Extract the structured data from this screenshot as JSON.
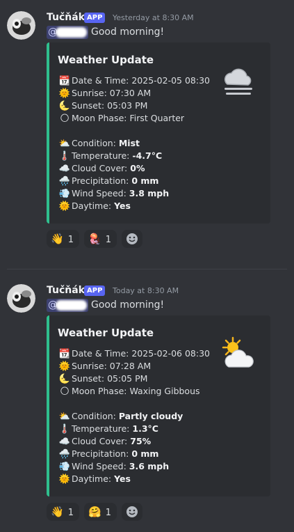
{
  "messages": [
    {
      "author": "Tučňák",
      "badge": "APP",
      "timestamp": "Yesterday at 8:30 AM",
      "mention": "@",
      "greeting": "Good morning!",
      "embed": {
        "title": "Weather Update",
        "thumbnail_icon": "fog-cloud-icon",
        "lines": [
          {
            "icon": "📆",
            "label": "Date & Time: ",
            "value": "2025-02-05 08:30",
            "bold": false
          },
          {
            "icon": "🌞",
            "label": "Sunrise: ",
            "value": "07:30 AM",
            "bold": false
          },
          {
            "icon": "🌜",
            "label": "Sunset: ",
            "value": "05:03 PM",
            "bold": false
          },
          {
            "icon": "🌕",
            "label": "Moon Phase: ",
            "value": "First Quarter",
            "bold": false
          }
        ],
        "conditions": [
          {
            "icon": "⛅",
            "label": "Condition: ",
            "value": "Mist"
          },
          {
            "icon": "🌡️",
            "label": "Temperature: ",
            "value": "-4.7°C"
          },
          {
            "icon": "☁️",
            "label": "Cloud Cover: ",
            "value": "0%"
          },
          {
            "icon": "🌧️",
            "label": "Precipitation: ",
            "value": "0 mm"
          },
          {
            "icon": "💨",
            "label": "Wind Speed: ",
            "value": "3.8 mph"
          },
          {
            "icon": "🌞",
            "label": "Daytime: ",
            "value": "Yes"
          }
        ]
      },
      "reactions": [
        {
          "emoji": "👋",
          "count": "1"
        },
        {
          "emoji": "🪼",
          "count": "1"
        }
      ]
    },
    {
      "author": "Tučňák",
      "badge": "APP",
      "timestamp": "Today at 8:30 AM",
      "mention": "@",
      "greeting": "Good morning!",
      "embed": {
        "title": "Weather Update",
        "thumbnail_icon": "sun-behind-cloud-icon",
        "lines": [
          {
            "icon": "📆",
            "label": "Date & Time: ",
            "value": "2025-02-06 08:30"
          },
          {
            "icon": "🌞",
            "label": "Sunrise: ",
            "value": "07:28 AM"
          },
          {
            "icon": "🌜",
            "label": "Sunset: ",
            "value": "05:05 PM"
          },
          {
            "icon": "🌕",
            "label": "Moon Phase: ",
            "value": "Waxing Gibbous"
          }
        ],
        "conditions": [
          {
            "icon": "⛅",
            "label": "Condition: ",
            "value": "Partly cloudy"
          },
          {
            "icon": "🌡️",
            "label": "Temperature: ",
            "value": "1.3°C"
          },
          {
            "icon": "☁️",
            "label": "Cloud Cover: ",
            "value": "75%"
          },
          {
            "icon": "🌧️",
            "label": "Precipitation: ",
            "value": "0 mm"
          },
          {
            "icon": "💨",
            "label": "Wind Speed: ",
            "value": "3.6 mph"
          },
          {
            "icon": "🌞",
            "label": "Daytime: ",
            "value": "Yes"
          }
        ]
      },
      "reactions": [
        {
          "emoji": "👋",
          "count": "1"
        },
        {
          "emoji": "🤗",
          "count": "1"
        }
      ]
    }
  ],
  "colors": {
    "background": "#313338",
    "embed_bg": "#2b2d31",
    "embed_accent": "#2fbf8e",
    "badge": "#5865f2"
  }
}
